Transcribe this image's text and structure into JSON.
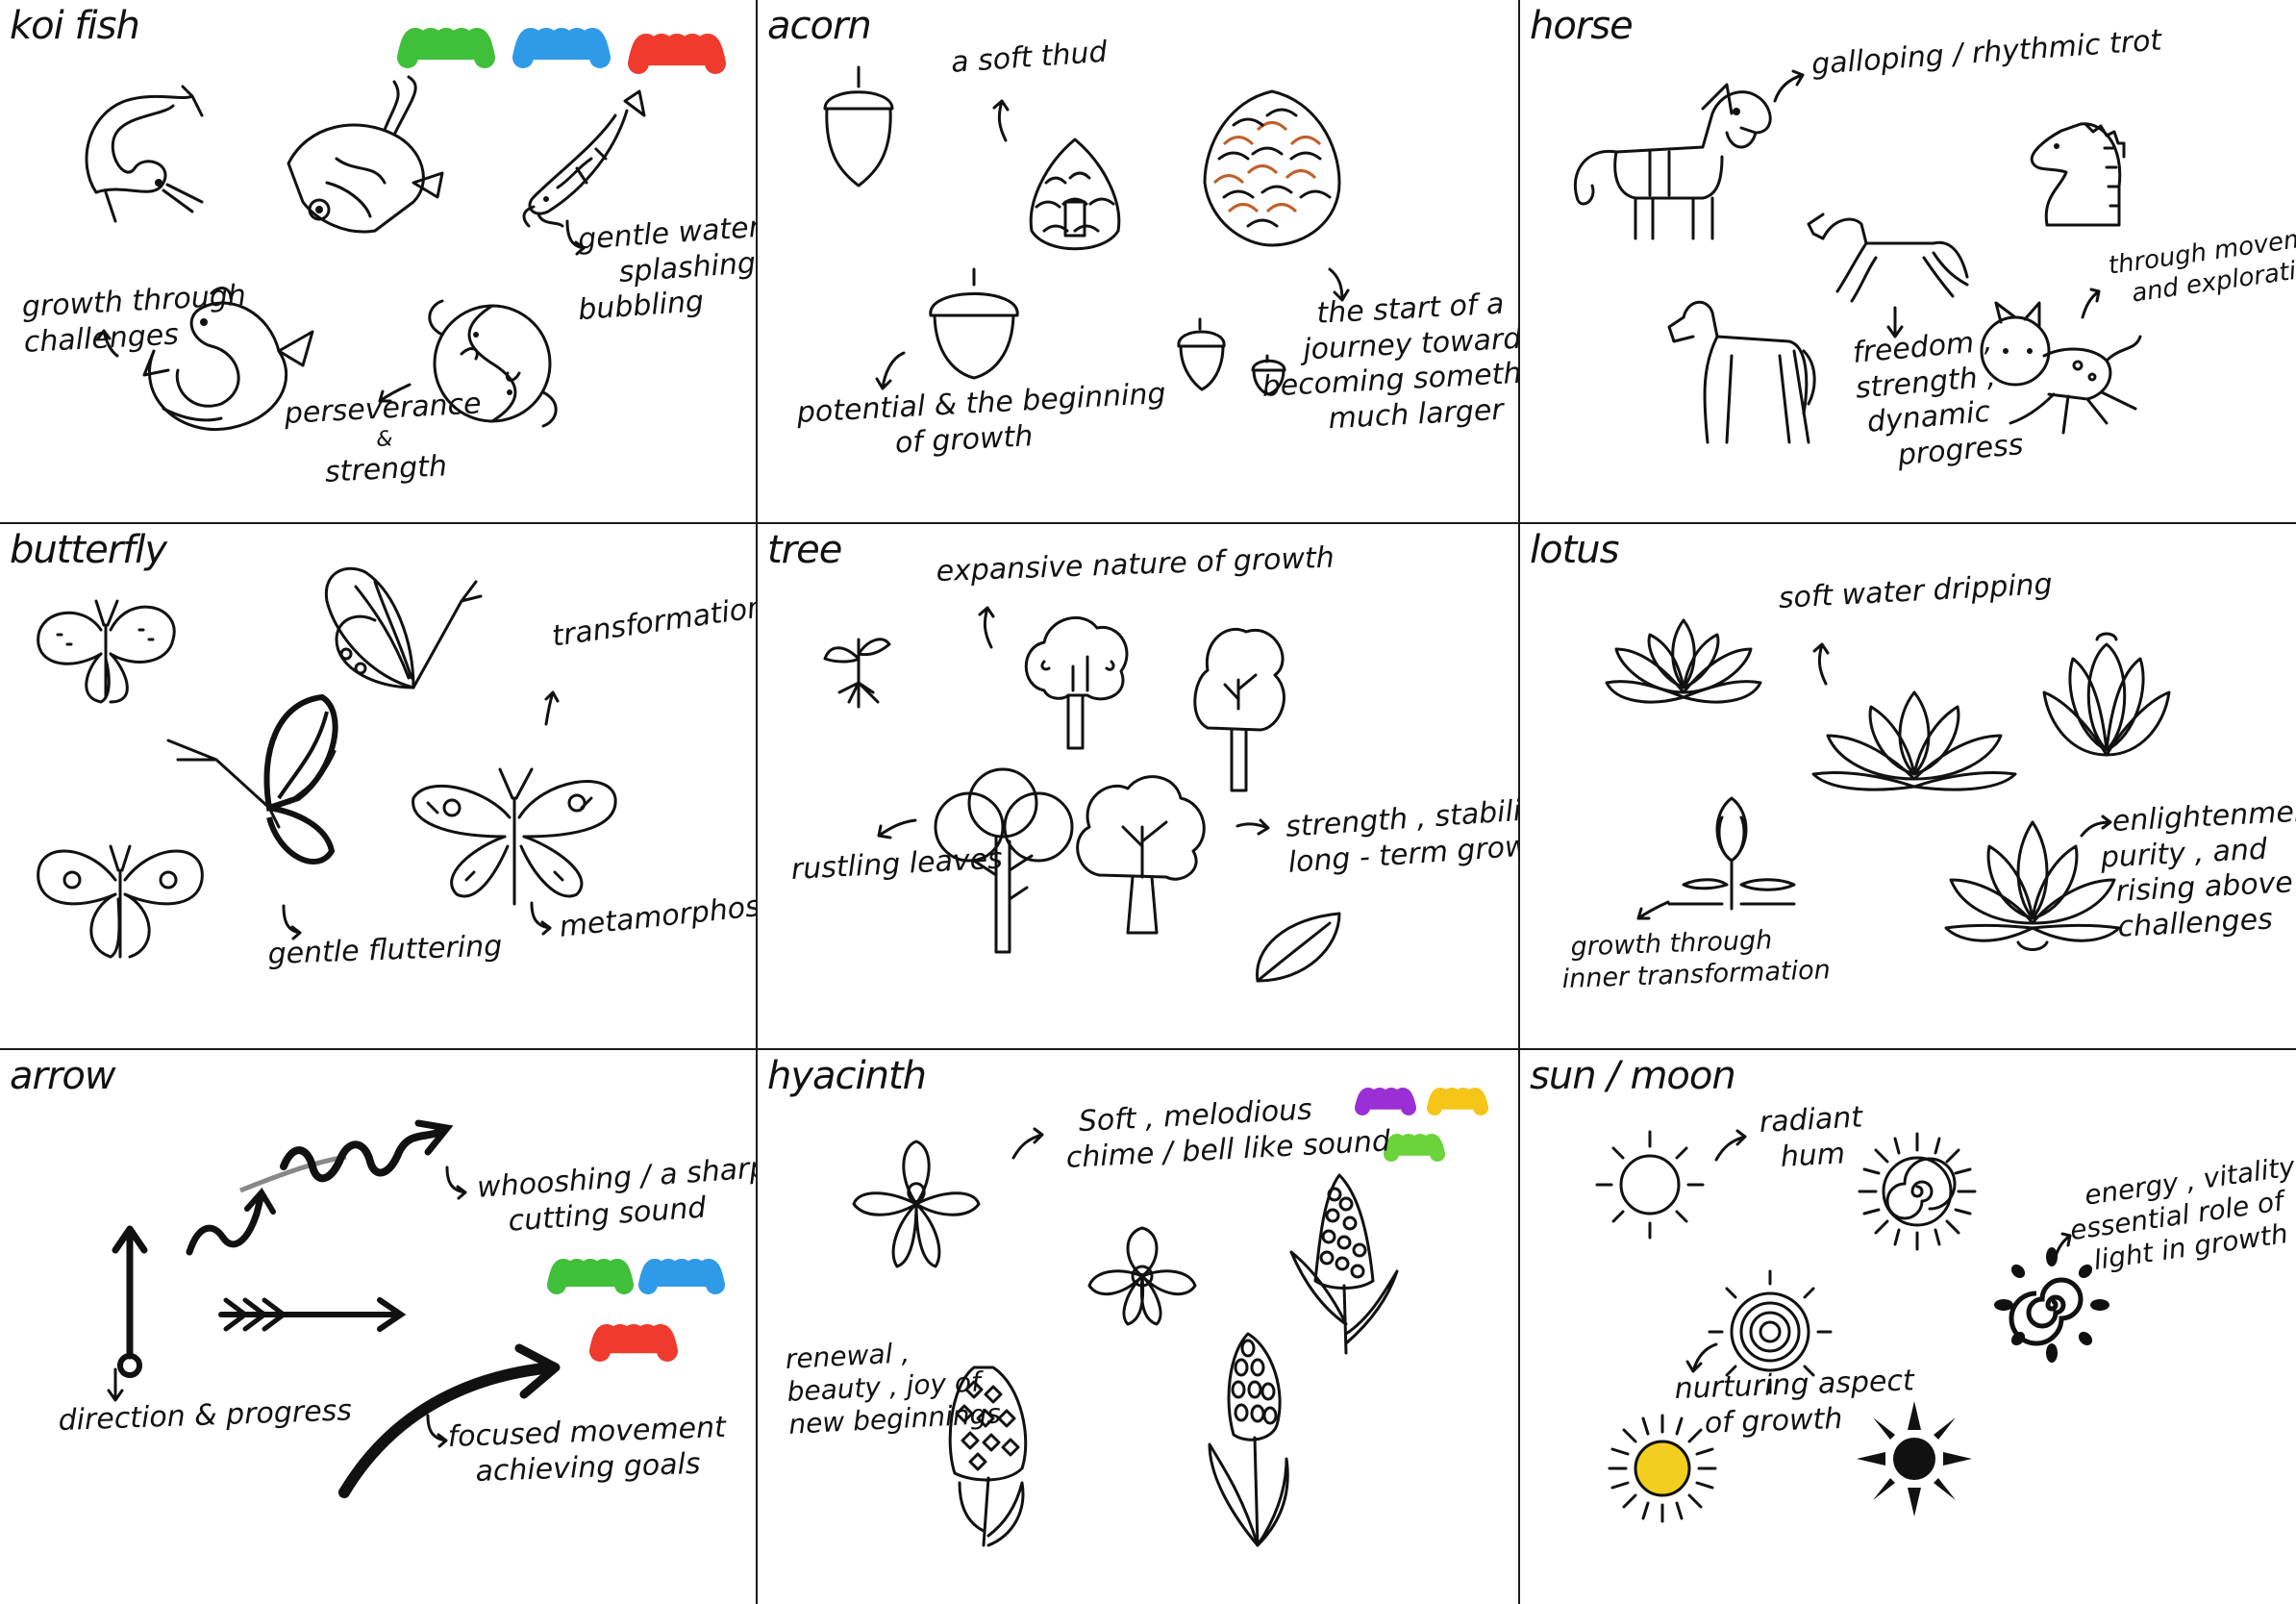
{
  "colors": {
    "green": "#3fbf3a",
    "blue": "#2f9ae8",
    "red": "#f03a2e",
    "purple": "#9b2fd6",
    "yellow": "#f5c518",
    "lime": "#6ad43a",
    "ink": "#111111",
    "sun_fill": "#f2cf1e",
    "acorn_brown": "#c0602a"
  },
  "panels": {
    "koi": {
      "title": "koi fish",
      "notes": {
        "water": [
          "gentle water",
          "splashing",
          "bubbling"
        ],
        "growth": [
          "growth through",
          "challenges"
        ],
        "strength": [
          "perseverance",
          "&",
          "strength"
        ]
      },
      "icons": [
        "koi-fish-icon",
        "koi-fish-icon",
        "koi-fish-icon",
        "koi-circle-icon",
        "koi-yin-yang-icon"
      ]
    },
    "acorn": {
      "title": "acorn",
      "notes": {
        "thud": [
          "a soft thud"
        ],
        "potential": [
          "potential & the beginning",
          "of growth"
        ],
        "journey": [
          "the start of a",
          "journey toward",
          "becoming something",
          "much larger"
        ]
      },
      "icons": [
        "acorn-icon",
        "pinecone-icon",
        "pinecone-icon",
        "acorn-icon",
        "acorn-pair-icon"
      ]
    },
    "horse": {
      "title": "horse",
      "notes": {
        "trot": [
          "galloping / rhythmic trot"
        ],
        "movement": [
          "through movement",
          "and exploration"
        ],
        "freedom": [
          "freedom ,",
          "strength ,",
          "dynamic",
          "progress"
        ]
      },
      "icons": [
        "pony-icon",
        "chess-knight-icon",
        "running-horse-icon",
        "walking-horse-icon",
        "cartoon-horse-icon"
      ]
    },
    "butterfly": {
      "title": "butterfly",
      "notes": {
        "transformation": [
          "transformation"
        ],
        "fluttering": [
          "gentle fluttering"
        ],
        "metamorphosis": [
          "metamorphosis"
        ]
      },
      "icons": [
        "butterfly-icon",
        "butterfly-icon",
        "butterfly-icon",
        "butterfly-icon",
        "butterfly-icon"
      ]
    },
    "tree": {
      "title": "tree",
      "notes": {
        "expansive": [
          "expansive nature of growth"
        ],
        "rustling": [
          "rustling leaves"
        ],
        "strength": [
          "strength , stability ,",
          "long - term growth"
        ]
      },
      "icons": [
        "sprout-icon",
        "tree-icon",
        "tree-icon",
        "tree-icon",
        "tree-icon",
        "leaf-icon"
      ]
    },
    "lotus": {
      "title": "lotus",
      "notes": {
        "dripping": [
          "soft water dripping"
        ],
        "growth": [
          "growth through",
          "inner transformation"
        ],
        "enlightenment": [
          "enlightenment ,",
          "purity , and",
          "rising above",
          "challenges"
        ]
      },
      "icons": [
        "lotus-icon",
        "lotus-icon",
        "lotus-icon",
        "lotus-bud-icon",
        "lotus-icon"
      ]
    },
    "arrow": {
      "title": "arrow",
      "notes": {
        "whoosh": [
          "whooshing / a sharp",
          "cutting sound"
        ],
        "direction": [
          "direction & progress"
        ],
        "focused": [
          "focused movement",
          "achieving goals"
        ]
      },
      "icons": [
        "squiggle-arrow-icon",
        "wave-arrow-icon",
        "arrow-up-icon",
        "feather-arrow-icon",
        "curved-arrow-icon"
      ]
    },
    "hyacinth": {
      "title": "hyacinth",
      "notes": {
        "chime": [
          "Soft , melodious",
          "chime / bell like sound"
        ],
        "renewal": [
          "renewal ,",
          "beauty , joy of",
          "new beginnings"
        ]
      },
      "icons": [
        "orchid-icon",
        "flower-icon",
        "hyacinth-icon",
        "hyacinth-icon",
        "hyacinth-icon"
      ]
    },
    "sunmoon": {
      "title": "sun / moon",
      "notes": {
        "hum": [
          "radiant",
          "hum"
        ],
        "energy": [
          "energy , vitality ,",
          "essential role of",
          "light in growth"
        ],
        "nurturing": [
          "nurturing aspect",
          "of growth"
        ]
      },
      "icons": [
        "sun-icon",
        "spiral-sun-icon",
        "concentric-sun-icon",
        "spiral-sun-icon",
        "sun-icon",
        "dark-sun-icon"
      ]
    }
  }
}
